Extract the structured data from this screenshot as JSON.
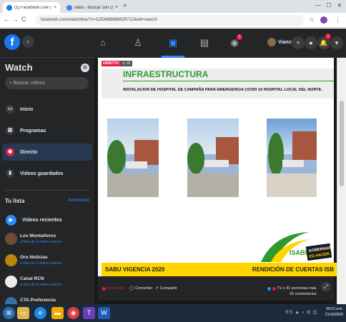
{
  "browser": {
    "tabs": [
      {
        "label": "(1) Facebook Live | Facebook",
        "color": "#1877f2",
        "active": true
      },
      {
        "label": "sabu - Buscar con Google",
        "color": "#4285f4",
        "active": false
      }
    ],
    "new_tab": "+",
    "url": "facebook.com/watch/live/?v=1253485886929712&ref=search",
    "window_buttons": {
      "min": "—",
      "max": "☐",
      "close": "✕"
    }
  },
  "fb": {
    "logo": "f",
    "search_icon": "search-icon",
    "nav": [
      "home-icon",
      "friends-icon",
      "watch-icon",
      "marketplace-icon",
      "groups-icon"
    ],
    "groups_badge": "2",
    "user_name": "Viancy",
    "bell_badge": "1"
  },
  "sidebar": {
    "title": "Watch",
    "search_placeholder": "Buscar videos",
    "items": [
      {
        "label": "Inicio",
        "icon": "tv-icon"
      },
      {
        "label": "Programas",
        "icon": "programs-icon"
      },
      {
        "label": "Directo",
        "icon": "live-icon",
        "active": true
      },
      {
        "label": "Videos guardados",
        "icon": "bookmark-icon"
      }
    ],
    "lista_title": "Tu lista",
    "admin_label": "Administrar",
    "recent_label": "Videos recientes",
    "channels": [
      {
        "name": "Los Montañeros",
        "sub": "● Más de 9 videos nuevos",
        "color": "#6d4c3a"
      },
      {
        "name": "Oro Noticias",
        "sub": "● Más de 9 videos nuevos",
        "color": "#b8860b"
      },
      {
        "name": "Canal RCN",
        "sub": "● Más de 9 videos nuevos",
        "color": "#ececec"
      },
      {
        "name": "CTA Preferencia",
        "sub": "",
        "color": "#3a6ea5"
      }
    ]
  },
  "video": {
    "live_badge": "DIRECTO",
    "views": "⊙ 15",
    "heading": "INFRAESTRUCTURA",
    "subheading": "INSTALACION DE HOSPITAL DE CAMPAÑA PARA EMERGENCIA COVID 19 HOSPITAL LOCAL DEL NORTE.",
    "logo_text": "ISABU",
    "logo_motto_1": "GOBERNAR",
    "logo_motto_2": "ES HACER",
    "footer_left": "SABU VIGENCIA 2020",
    "footer_right": "RENDICIÓN DE CUENTAS ISB"
  },
  "controls": {
    "live_label": "En directo",
    "comment_label": "Comentar",
    "share_label": "Compartir",
    "reactions": "Tú y 41 personas más",
    "comments": "26 comentarios"
  },
  "taskbar": {
    "tray": "ES ▲ ♪ ⊡ ◫",
    "time": "09:12 a.m.",
    "date": "21/10/2020"
  }
}
